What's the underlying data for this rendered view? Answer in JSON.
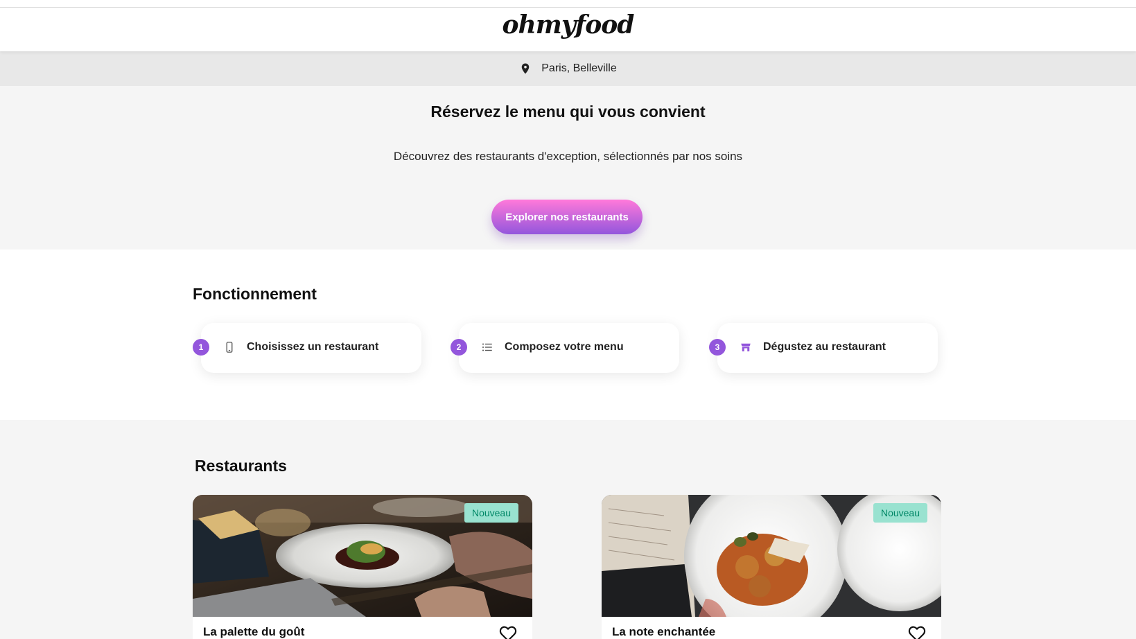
{
  "header": {
    "logo": "ohmyfood"
  },
  "location": {
    "icon": "map-pin-icon",
    "text": "Paris, Belleville"
  },
  "hero": {
    "title": "Réservez le menu qui vous convient",
    "subtitle": "Découvrez des restaurants d'exception, sélectionnés par nos soins",
    "cta_label": "Explorer nos restaurants"
  },
  "how_it_works": {
    "title": "Fonctionnement",
    "steps": [
      {
        "number": "1",
        "icon": "mobile-phone-icon",
        "label": "Choisissez un restaurant"
      },
      {
        "number": "2",
        "icon": "list-icon",
        "label": "Composez votre menu"
      },
      {
        "number": "3",
        "icon": "store-icon",
        "label": "Dégustez au restaurant"
      }
    ]
  },
  "restaurants": {
    "title": "Restaurants",
    "items": [
      {
        "name": "La palette du goût",
        "badge": "Nouveau",
        "favorite_icon": "heart-outline-icon"
      },
      {
        "name": "La note enchantée",
        "badge": "Nouveau",
        "favorite_icon": "heart-outline-icon"
      }
    ]
  },
  "colors": {
    "primary": "#9356dc",
    "gradient_start": "#ff79da",
    "gradient_end": "#9356dc",
    "badge_bg": "#99e2d0",
    "badge_text": "#008766",
    "section_bg": "#f5f5f5",
    "location_bg": "#e8e8e8"
  }
}
